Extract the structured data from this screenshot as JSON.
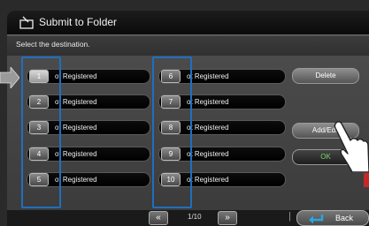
{
  "header": {
    "title": "Submit to Folder"
  },
  "subtitle": "Select the destination.",
  "left_column": [
    {
      "number": "1",
      "label": "ot Registered",
      "selected": true
    },
    {
      "number": "2",
      "label": "ot Registered",
      "selected": false
    },
    {
      "number": "3",
      "label": "ot Registered",
      "selected": false
    },
    {
      "number": "4",
      "label": "ot Registered",
      "selected": false
    },
    {
      "number": "5",
      "label": "ot Registered",
      "selected": false
    }
  ],
  "right_column": [
    {
      "number": "6",
      "label": "ot Registered"
    },
    {
      "number": "7",
      "label": "ot Registered"
    },
    {
      "number": "8",
      "label": "ot Registered"
    },
    {
      "number": "9",
      "label": "ot Registered"
    },
    {
      "number": "10",
      "label": "ot Registered"
    }
  ],
  "actions": {
    "delete_label": "Delete",
    "add_edit_label": "Add/Edit",
    "ok_label": "OK"
  },
  "pagination": {
    "prev_glyph": "«",
    "next_glyph": "»",
    "page_text": "1/10"
  },
  "footer": {
    "back_label": "Back"
  },
  "colors": {
    "highlight": "#1f6fbf",
    "ok_text": "#7fd36a",
    "back_icon": "#2aa6e0"
  },
  "icons": {
    "title": "folder-edit-icon",
    "back": "return-arrow-icon",
    "pointer": "pointing-hand-icon",
    "callout": "callout-arrow-icon"
  }
}
